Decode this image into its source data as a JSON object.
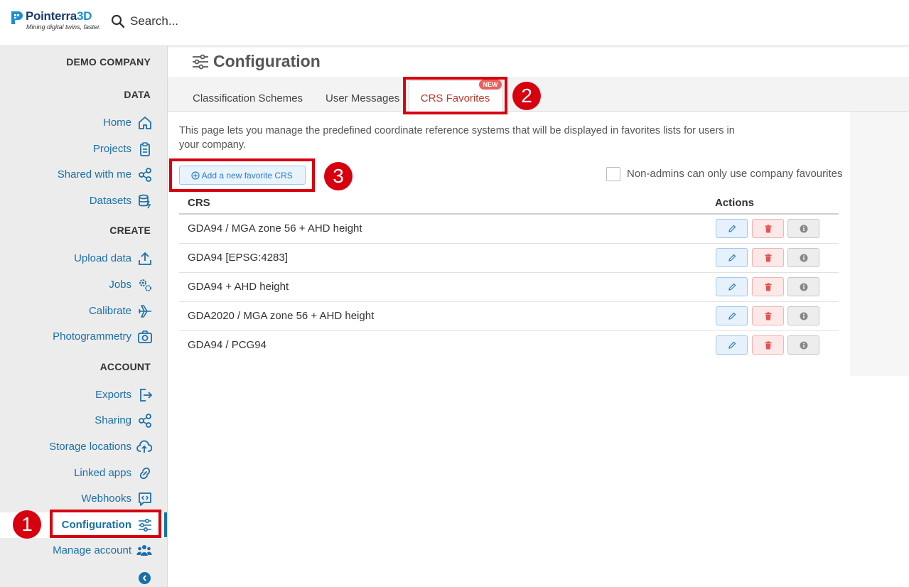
{
  "header": {
    "logo_name": "Pointerra",
    "logo_suffix": "3D",
    "logo_tagline": "Mining digital twins, faster.",
    "search_placeholder": "Search..."
  },
  "sidebar": {
    "company": "DEMO COMPANY",
    "sections": [
      {
        "heading": "DATA",
        "items": [
          {
            "label": "Home",
            "icon": "home-icon"
          },
          {
            "label": "Projects",
            "icon": "clipboard-icon"
          },
          {
            "label": "Shared with me",
            "icon": "share-icon"
          },
          {
            "label": "Datasets",
            "icon": "database-icon"
          }
        ]
      },
      {
        "heading": "CREATE",
        "items": [
          {
            "label": "Upload data",
            "icon": "upload-icon"
          },
          {
            "label": "Jobs",
            "icon": "gears-icon"
          },
          {
            "label": "Calibrate",
            "icon": "plane-icon"
          },
          {
            "label": "Photogrammetry",
            "icon": "camera-icon"
          }
        ]
      },
      {
        "heading": "ACCOUNT",
        "items": [
          {
            "label": "Exports",
            "icon": "export-icon"
          },
          {
            "label": "Sharing",
            "icon": "share-icon"
          },
          {
            "label": "Storage locations",
            "icon": "cloud-upload-icon"
          },
          {
            "label": "Linked apps",
            "icon": "link-icon"
          },
          {
            "label": "Webhooks",
            "icon": "webhook-icon"
          },
          {
            "label": "Configuration",
            "icon": "sliders-icon",
            "active": true
          },
          {
            "label": "Manage account",
            "icon": "users-icon"
          }
        ]
      }
    ]
  },
  "main": {
    "title": "Configuration",
    "tabs": [
      {
        "label": "Classification Schemes"
      },
      {
        "label": "User Messages"
      },
      {
        "label": "CRS Favorites",
        "active": true,
        "badge": "NEW"
      }
    ],
    "description": "This page lets you manage the predefined coordinate reference systems that will be displayed in favorites lists for users in your company.",
    "add_button": "Add a new favorite CRS",
    "checkbox_label": "Non-admins can only use company favourites",
    "checkbox_checked": false,
    "table": {
      "columns": [
        "CRS",
        "Actions"
      ],
      "rows": [
        "GDA94 / MGA zone 56 + AHD height",
        "GDA94 [EPSG:4283]",
        "GDA94 + AHD height",
        "GDA2020 / MGA zone 56 + AHD height",
        "GDA94 / PCG94"
      ]
    }
  },
  "callouts": [
    "1",
    "2",
    "3"
  ],
  "colors": {
    "accent": "#1b6fa8",
    "callout": "#d7000f",
    "danger": "#e55353",
    "badge": "#e8615a"
  }
}
